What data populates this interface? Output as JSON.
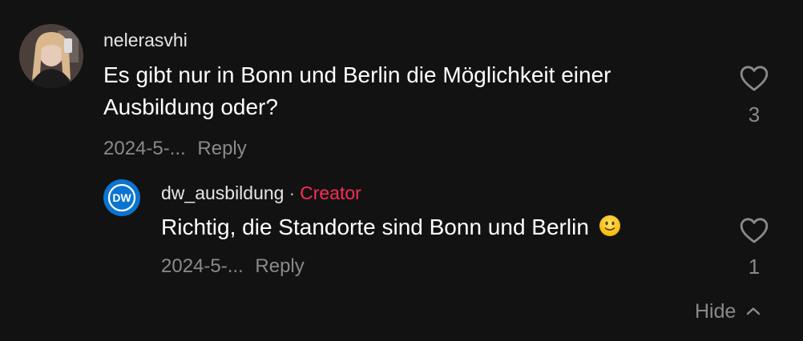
{
  "comments": [
    {
      "username": "nelerasvhi",
      "text_line1": "Es gibt nur in Bonn und Berlin die Möglichkeit einer",
      "text_line2": "Ausbildung oder?",
      "date": "2024-5-...",
      "reply_label": "Reply",
      "likes": "3",
      "avatar_icon": "user-photo-avatar"
    }
  ],
  "replies": [
    {
      "username": "dw_ausbildung",
      "separator": "·",
      "badge": "Creator",
      "text": "Richtig, die Standorte sind Bonn und Berlin",
      "emoji": "slightly-smiling-face-emoji",
      "date": "2024-5-...",
      "reply_label": "Reply",
      "likes": "1",
      "avatar_text": "DW",
      "avatar_color": "#0b74d1"
    }
  ],
  "hide_label": "Hide",
  "colors": {
    "background": "#121212",
    "creator_badge": "#fe2c55",
    "muted_text": "#8a8a8a"
  }
}
